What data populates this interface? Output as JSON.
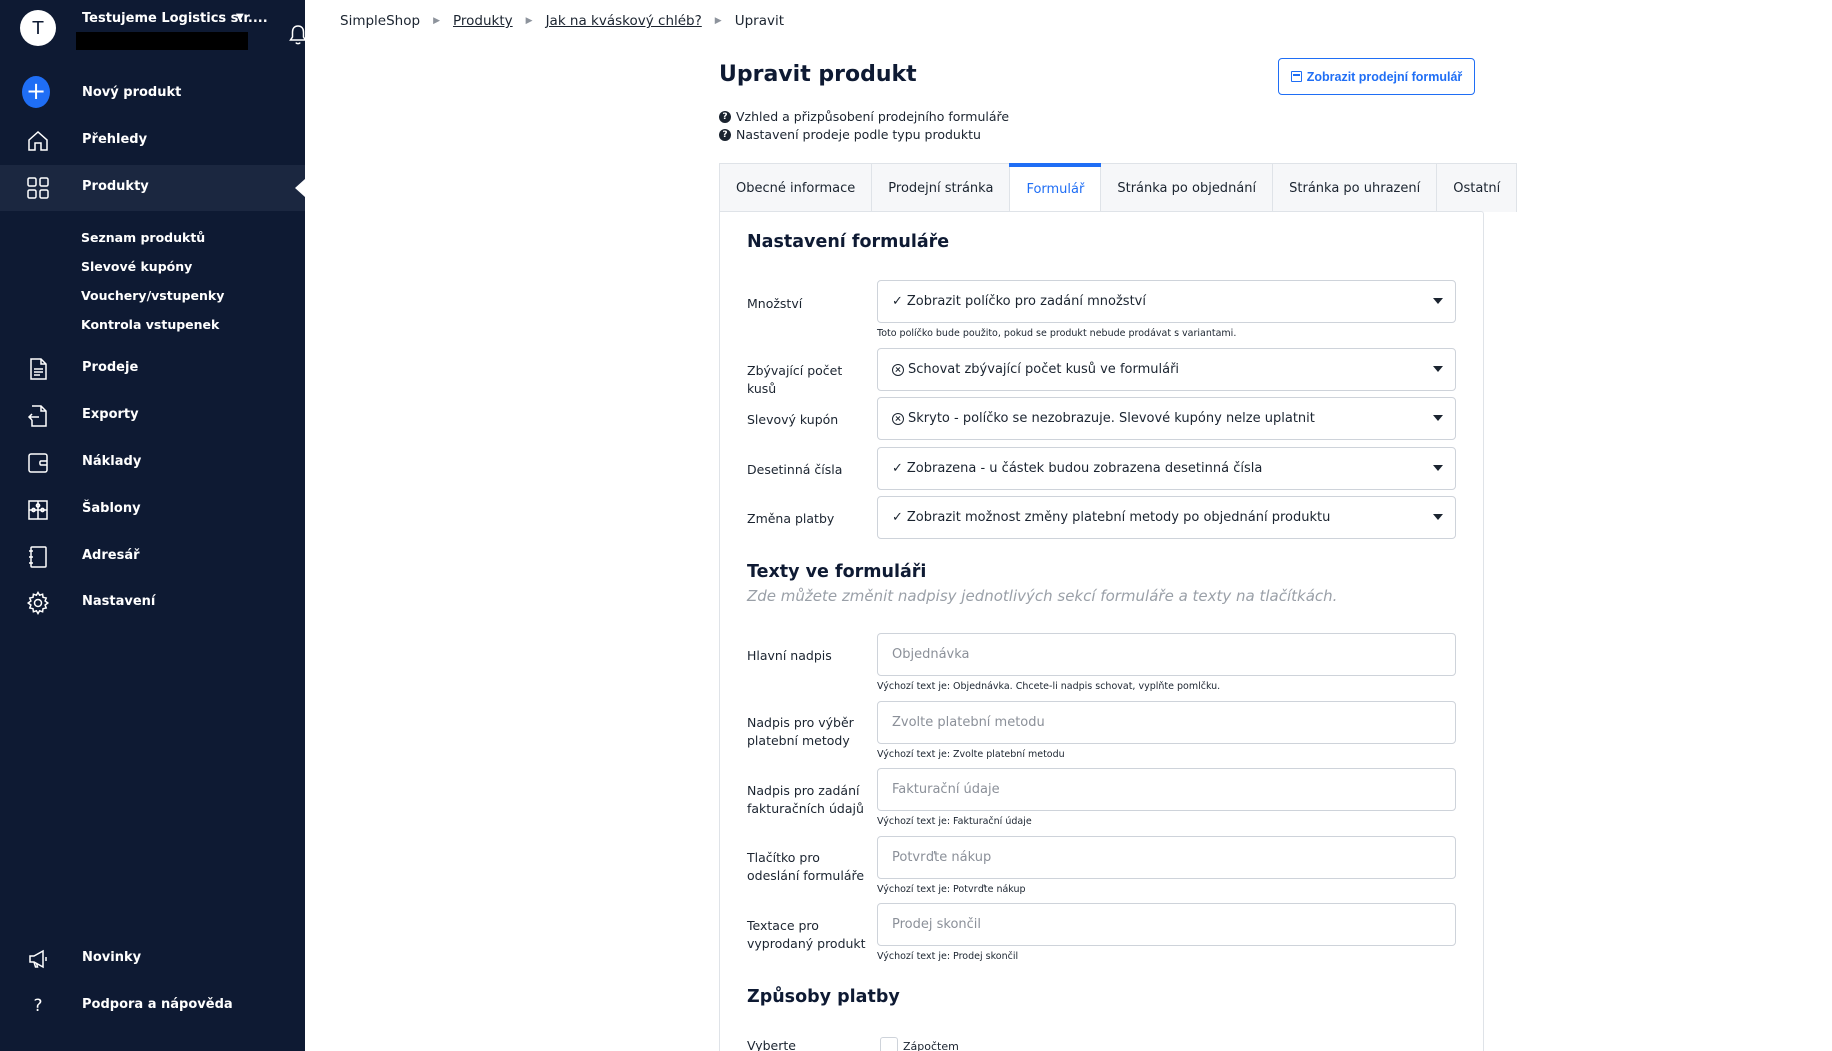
{
  "account": {
    "avatar_letter": "T",
    "name": "Testujeme Logistics s.r...."
  },
  "sidebar": {
    "new_product": "Nový produkt",
    "overview": "Přehledy",
    "products": "Produkty",
    "sub": [
      "Seznam produktů",
      "Slevové kupóny",
      "Vouchery/vstupenky",
      "Kontrola vstupenek"
    ],
    "sales": "Prodeje",
    "exports": "Exporty",
    "costs": "Náklady",
    "templates": "Šablony",
    "addressbook": "Adresář",
    "settings": "Nastavení",
    "news": "Novinky",
    "support": "Podpora a nápověda"
  },
  "breadcrumb": [
    "SimpleShop",
    "Produkty",
    "Jak na kváskový chléb?",
    "Upravit"
  ],
  "page": {
    "title": "Upravit produkt",
    "show_form_button": "Zobrazit prodejní formulář",
    "help_1": "Vzhled a přizpůsobení prodejního formuláře",
    "help_2": "Nastavení prodeje podle typu produktu"
  },
  "tabs": [
    "Obecné informace",
    "Prodejní stránka",
    "Formulář",
    "Stránka po objednání",
    "Stránka po uhrazení",
    "Ostatní"
  ],
  "form_settings": {
    "title": "Nastavení formuláře",
    "rows": [
      {
        "label": "Množství",
        "value": "Zobrazit políčko pro zadání množství",
        "mark": "✓",
        "hint": "Toto políčko bude použito, pokud se produkt nebude prodávat s variantami."
      },
      {
        "label": "Zbývající počet kusů",
        "value": "Schovat zbývající počet kusů ve formuláři",
        "mark": "x"
      },
      {
        "label": "Slevový kupón",
        "value": "Skryto - políčko se nezobrazuje. Slevové kupóny nelze uplatnit",
        "mark": "x"
      },
      {
        "label": "Desetinná čísla",
        "value": "Zobrazena - u částek budou zobrazena desetinná čísla",
        "mark": "✓"
      },
      {
        "label": "Změna platby",
        "value": "Zobrazit možnost změny platební metody po objednání produktu",
        "mark": "✓"
      }
    ]
  },
  "form_texts": {
    "title": "Texty ve formuláři",
    "subtitle": "Zde můžete změnit nadpisy jednotlivých sekcí formuláře a texty na tlačítkách.",
    "rows": [
      {
        "label": "Hlavní nadpis",
        "placeholder": "Objednávka",
        "hint": "Výchozí text je: Objednávka. Chcete-li nadpis schovat, vyplňte pomlčku."
      },
      {
        "label": "Nadpis pro výběr platební metody",
        "placeholder": "Zvolte platební metodu",
        "hint": "Výchozí text je: Zvolte platební metodu"
      },
      {
        "label": "Nadpis pro zadání fakturačních údajů",
        "placeholder": "Fakturační údaje",
        "hint": "Výchozí text je: Fakturační údaje"
      },
      {
        "label": "Tlačítko pro odeslání formuláře",
        "placeholder": "Potvrďte nákup",
        "hint": "Výchozí text je: Potvrďte nákup"
      },
      {
        "label": "Textace pro vyprodaný produkt",
        "placeholder": "Prodej skončil",
        "hint": "Výchozí text je: Prodej skončil"
      }
    ]
  },
  "payment": {
    "title": "Způsoby platby",
    "label": "Vyberte",
    "option": "Zápočtem"
  },
  "colors": {
    "sidebar": "#0e1a33",
    "accent": "#1f6ef5"
  }
}
